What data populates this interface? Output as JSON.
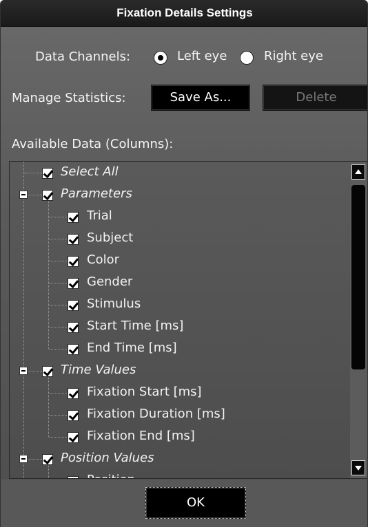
{
  "window": {
    "title": "Fixation Details Settings"
  },
  "data_channels": {
    "label": "Data Channels:",
    "options": [
      {
        "label": "Left eye",
        "selected": true
      },
      {
        "label": "Right eye",
        "selected": false
      }
    ]
  },
  "manage_statistics": {
    "label": "Manage Statistics:",
    "save_as": "Save As...",
    "delete": "Delete"
  },
  "available": {
    "label": "Available Data (Columns):",
    "tree": [
      {
        "label": "Select All",
        "italic": true,
        "checked": true
      },
      {
        "label": "Parameters",
        "italic": true,
        "checked": true,
        "expanded": true
      },
      {
        "label": "Trial",
        "checked": true
      },
      {
        "label": "Subject",
        "checked": true
      },
      {
        "label": "Color",
        "checked": true
      },
      {
        "label": "Gender",
        "checked": true
      },
      {
        "label": "Stimulus",
        "checked": true
      },
      {
        "label": "Start Time [ms]",
        "checked": true
      },
      {
        "label": "End Time [ms]",
        "checked": true
      },
      {
        "label": "Time Values",
        "italic": true,
        "checked": true,
        "expanded": true
      },
      {
        "label": "Fixation Start [ms]",
        "checked": true
      },
      {
        "label": "Fixation Duration [ms]",
        "checked": true
      },
      {
        "label": "Fixation End [ms]",
        "checked": true
      },
      {
        "label": "Position Values",
        "italic": true,
        "checked": true,
        "expanded": true
      },
      {
        "label": "Position",
        "checked": true
      }
    ]
  },
  "footer": {
    "ok": "OK"
  }
}
